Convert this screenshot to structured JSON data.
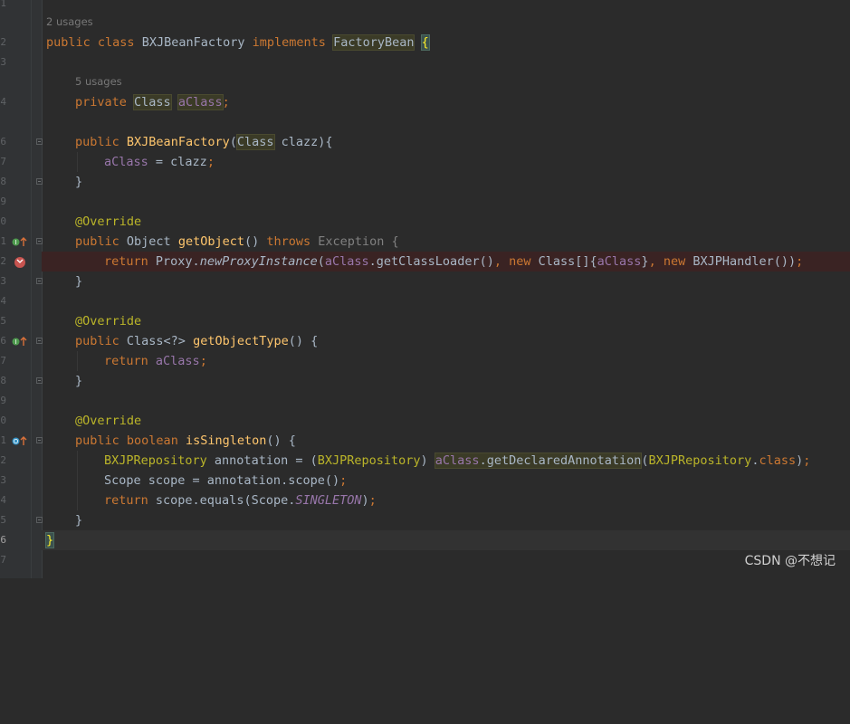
{
  "editor": {
    "line_numbers": [
      "1",
      "2",
      "3",
      "",
      "4",
      "5",
      "6",
      "7",
      "8",
      "9",
      "0",
      "1",
      "2",
      "3",
      "4",
      "5",
      "6",
      "7",
      "8",
      "9",
      "0",
      "1",
      "2",
      "3",
      "4",
      "5",
      "6",
      "7"
    ],
    "hints": {
      "class_usages": "2 usages",
      "field_usages": "5 usages"
    },
    "code": {
      "l2": {
        "a": "public",
        "b": "class",
        "c": "BXJBeanFactory",
        "d": "implements",
        "e": "FactoryBean",
        "f": "{"
      },
      "l4": {
        "a": "private",
        "b": "Class",
        "c": "aClass",
        "d": ";"
      },
      "l6": {
        "a": "public",
        "b": "BXJBeanFactory",
        "c": "(",
        "d": "Class",
        "e": " clazz){"
      },
      "l7": {
        "a": "aClass",
        "b": " = clazz",
        "c": ";"
      },
      "l8": {
        "a": "}"
      },
      "l10": {
        "a": "@Override"
      },
      "l11": {
        "a": "public",
        "b": " Object ",
        "c": "getObject",
        "d": "() ",
        "e": "throws",
        "f": " Exception {"
      },
      "l12": {
        "a": "return",
        "b": " Proxy.",
        "c": "newProxyInstance",
        "d": "(",
        "e": "aClass",
        "f": ".getClassLoader()",
        "g": ", ",
        "h": "new",
        "i": " Class[]{",
        "j": "aClass",
        "k": "}",
        "l": ", ",
        "m": "new",
        "n": " BXJPHandler())",
        "o": ";"
      },
      "l13": {
        "a": "}"
      },
      "l15": {
        "a": "@Override"
      },
      "l16": {
        "a": "public",
        "b": " Class<?> ",
        "c": "getObjectType",
        "d": "() {"
      },
      "l17": {
        "a": "return",
        "b": "aClass",
        "c": ";"
      },
      "l18": {
        "a": "}"
      },
      "l20": {
        "a": "@Override"
      },
      "l21": {
        "a": "public",
        "b": "boolean",
        "c": "isSingleton",
        "d": "() {"
      },
      "l22": {
        "a": "BXJPRepository",
        "b": " annotation = (",
        "c": "BXJPRepository",
        "d": ") ",
        "e": "aClass",
        "f": ".getDeclaredAnnotation",
        "g": "(",
        "h": "BXJPRepository",
        "i": ".",
        "j": "class",
        "k": ")",
        "l": ";"
      },
      "l23": {
        "a": "Scope scope = annotation.scope()",
        "b": ";"
      },
      "l24": {
        "a": "return",
        "b": " scope.equals(Scope.",
        "c": "SINGLETON",
        "d": ")",
        "e": ";"
      },
      "l25": {
        "a": "}"
      },
      "l26": {
        "a": "}"
      }
    }
  },
  "watermark": "CSDN @不想记",
  "colors": {
    "background": "#2b2b2b",
    "keyword": "#cc7832",
    "method": "#ffc66d",
    "field": "#9876aa",
    "annotation": "#bbb529",
    "text": "#a9b7c6"
  }
}
